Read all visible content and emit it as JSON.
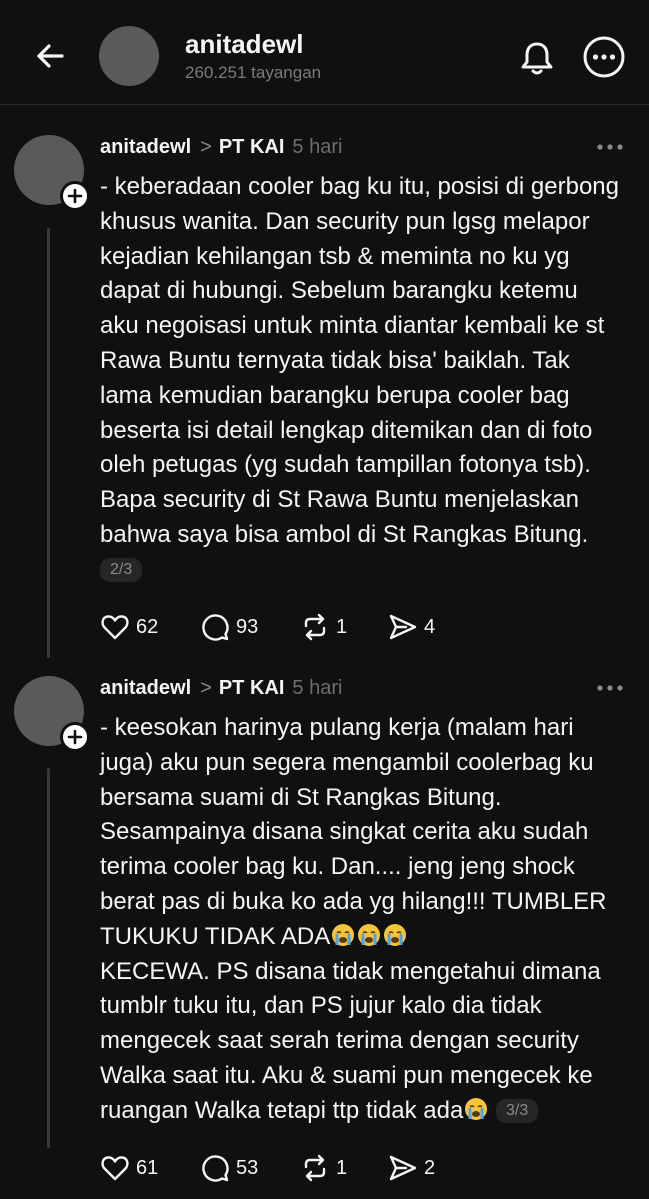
{
  "header": {
    "username": "anitadewl",
    "views": "260.251 tayangan"
  },
  "posts": [
    {
      "username": "anitadewl",
      "recipient": "PT KAI",
      "time": "5 hari",
      "lines": [
        "- keberadaan cooler bag ku itu, posisi di gerbong",
        "khusus wanita. Dan security pun lgsg melapor",
        "kejadian kehilangan tsb & meminta no ku yg",
        "dapat di hubungi. Sebelum barangku ketemu",
        "aku negoisasi untuk minta diantar kembali ke st",
        "Rawa Buntu ternyata tidak bisa' baiklah. Tak",
        "lama kemudian barangku berupa cooler bag",
        "beserta isi detail lengkap ditemikan dan di foto",
        "oleh petugas (yg sudah tampillan fotonya tsb).",
        "Bapa security di St Rawa Buntu menjelaskan",
        "bahwa saya bisa ambol di St Rangkas Bitung."
      ],
      "page": "2/3",
      "likes": "62",
      "replies": "93",
      "reposts": "1",
      "shares": "4"
    },
    {
      "username": "anitadewl",
      "recipient": "PT KAI",
      "time": "5 hari",
      "lines": [
        "- keesokan harinya pulang kerja (malam hari",
        "juga) aku pun segera mengambil coolerbag ku",
        "bersama suami di St Rangkas Bitung.",
        "Sesampainya disana singkat cerita aku sudah",
        "terima cooler bag ku. Dan.... jeng jeng shock",
        "berat pas di buka ko ada yg hilang!!! TUMBLER",
        "TUKUKU TIDAK ADA",
        "KECEWA. PS disana tidak mengetahui dimana",
        "tumblr tuku itu, dan PS jujur kalo dia tidak",
        "mengecek saat serah terima dengan security",
        "Walka saat itu. Aku & suami pun mengecek ke",
        "ruangan Walka tetapi ttp tidak ada"
      ],
      "page": "3/3",
      "likes": "61",
      "replies": "53",
      "reposts": "1",
      "shares": "2"
    }
  ]
}
